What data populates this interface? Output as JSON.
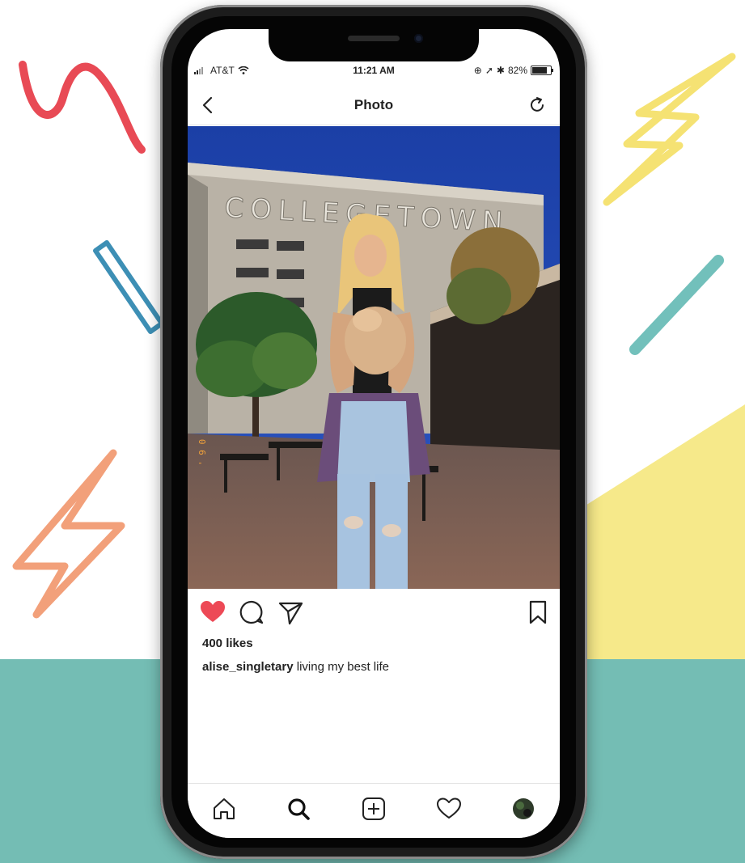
{
  "status_bar": {
    "carrier": "AT&T",
    "time": "11:21 AM",
    "battery": "82%",
    "battery_level": 0.82
  },
  "navbar": {
    "title": "Photo",
    "back_icon": "chevron-left-icon",
    "refresh_icon": "refresh-icon"
  },
  "post": {
    "photo_sign_text": "COLLEGETOWN",
    "liked": true,
    "likes": "400 likes",
    "username": "alise_singletary",
    "caption": "living my best life",
    "action_icons": [
      "heart-icon",
      "comment-icon",
      "share-icon",
      "bookmark-icon"
    ]
  },
  "tab_bar": {
    "items": [
      "home-icon",
      "search-icon",
      "add-post-icon",
      "activity-heart-icon",
      "profile-avatar"
    ]
  },
  "colors": {
    "teal": "#74bdb4",
    "yellow": "#f6e98a",
    "heart_red": "#ed4956",
    "scribble_red": "#e84a55",
    "bolt_orange": "#f2a07a",
    "bolt_yellow": "#f5e273",
    "stick_blue": "#3d8fb5"
  }
}
